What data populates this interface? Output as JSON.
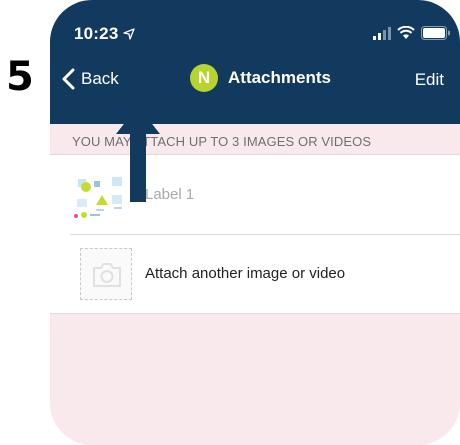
{
  "annotation": {
    "step_number": "5"
  },
  "status_bar": {
    "time": "10:23"
  },
  "navbar": {
    "back_label": "Back",
    "avatar_initial": "N",
    "title": "Attachments",
    "edit_label": "Edit"
  },
  "section": {
    "header": "YOU MAY ATTACH UP TO 3 IMAGES OR VIDEOS"
  },
  "attachments": {
    "items": [
      {
        "label": "Label 1",
        "icon": "diagram-thumbnail"
      },
      {
        "label": "Attach another image or video",
        "icon": "camera-icon"
      }
    ]
  },
  "colors": {
    "navbar": "#123a5e",
    "avatar": "#b6d330",
    "background": "#fae9ec",
    "arrow": "#123a5e"
  }
}
